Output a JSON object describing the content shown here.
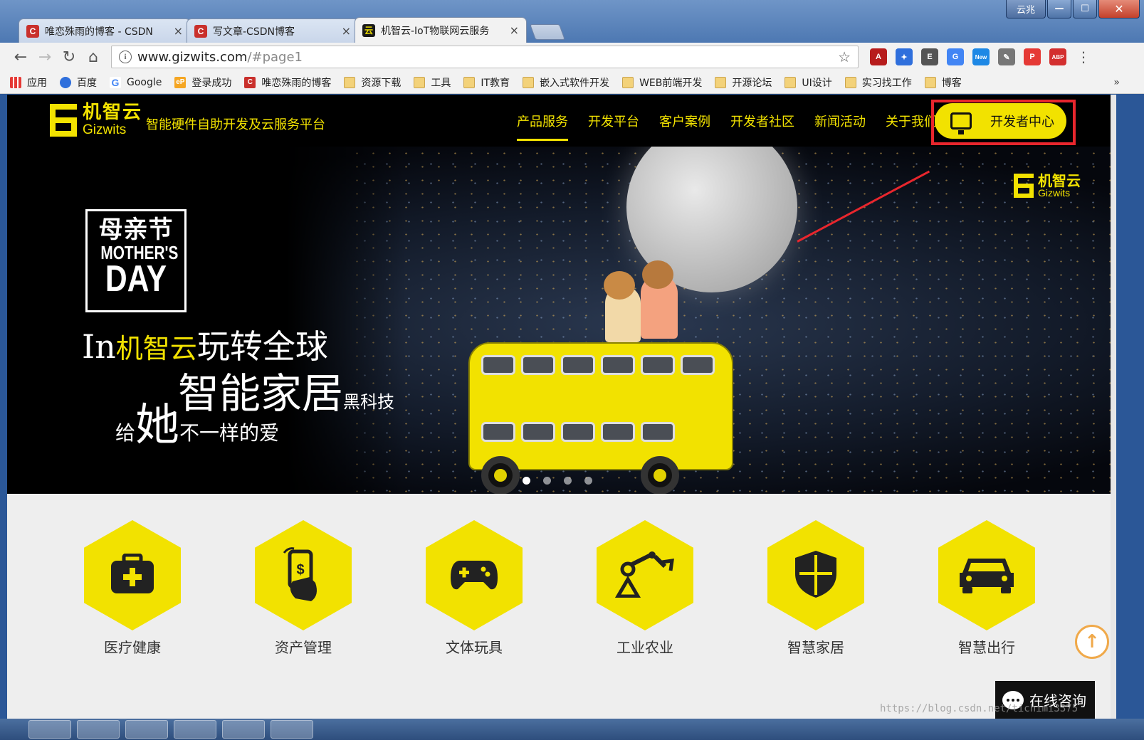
{
  "browser": {
    "window_user_label": "云兆",
    "tabs": [
      {
        "favicon": "C",
        "title": "唯恋殊雨的博客 - CSDN",
        "close": "×"
      },
      {
        "favicon": "C",
        "title": "写文章-CSDN博客",
        "close": "×"
      },
      {
        "favicon": "云",
        "title": "机智云-IoT物联网云服务",
        "close": "×"
      }
    ],
    "address": {
      "host": "www.gizwits.com",
      "path": "/#page1"
    },
    "extensions": [
      {
        "name": "pdf-extension-icon",
        "color": "#b71c1c",
        "glyph": "A"
      },
      {
        "name": "baidu-paw-icon",
        "color": "#2f6fdc",
        "glyph": "✦"
      },
      {
        "name": "evernote-icon",
        "color": "#555555",
        "glyph": "E"
      },
      {
        "name": "translate-icon",
        "color": "#4285f4",
        "glyph": "G"
      },
      {
        "name": "new-extension-icon",
        "color": "#1e88e5",
        "glyph": "New"
      },
      {
        "name": "eyedropper-icon",
        "color": "#777777",
        "glyph": "✎"
      },
      {
        "name": "pocket-icon",
        "color": "#e53935",
        "glyph": "P"
      },
      {
        "name": "adblock-plus-icon",
        "color": "#d32f2f",
        "glyph": "ABP"
      }
    ],
    "bookmarks": [
      {
        "icon": "apps",
        "label": "应用"
      },
      {
        "icon": "baidu",
        "label": "百度"
      },
      {
        "icon": "google",
        "label": "Google"
      },
      {
        "icon": "ep",
        "label": "登录成功"
      },
      {
        "icon": "csdn",
        "label": "唯恋殊雨的博客"
      },
      {
        "icon": "folder",
        "label": "资源下载"
      },
      {
        "icon": "folder",
        "label": "工具"
      },
      {
        "icon": "folder",
        "label": "IT教育"
      },
      {
        "icon": "folder",
        "label": "嵌入式软件开发"
      },
      {
        "icon": "folder",
        "label": "WEB前端开发"
      },
      {
        "icon": "folder",
        "label": "开源论坛"
      },
      {
        "icon": "folder",
        "label": "UI设计"
      },
      {
        "icon": "folder",
        "label": "实习找工作"
      },
      {
        "icon": "folder",
        "label": "博客"
      }
    ],
    "bookmarks_more": "»"
  },
  "site": {
    "logo_cn": "机智云",
    "logo_en": "Gizwits",
    "slogan": "智能硬件自助开发及云服务平台",
    "nav": [
      "产品服务",
      "开发平台",
      "客户案例",
      "开发者社区",
      "新闻活动",
      "关于我们"
    ],
    "dev_center": "开发者中心",
    "accent": "#f2e200",
    "annotation_color": "#e8262d"
  },
  "banner": {
    "logo_cn": "机智云",
    "logo_en": "Gizwits",
    "mothers_day_cn": "母亲节",
    "mothers_day_en1": "MOTHER'S",
    "mothers_day_en2": "DAY",
    "line1_prefix": "In",
    "line1_brand": "机智云",
    "line1_suffix": "玩转全球",
    "line2": "智能家居",
    "line2_small": "黑科技",
    "line3_prefix": "给",
    "line3_big": "她",
    "line3_suffix": "不一样的爱",
    "slides": 4,
    "active_slide": 1
  },
  "industries": [
    {
      "icon": "medical-kit-icon",
      "label": "医疗健康"
    },
    {
      "icon": "phone-payment-icon",
      "label": "资产管理"
    },
    {
      "icon": "gamepad-icon",
      "label": "文体玩具"
    },
    {
      "icon": "robot-arm-icon",
      "label": "工业农业"
    },
    {
      "icon": "shield-icon",
      "label": "智慧家居"
    },
    {
      "icon": "car-icon",
      "label": "智慧出行"
    }
  ],
  "chat": {
    "label": "在线咨询"
  },
  "to_top": "↑",
  "watermark": "https://blog.csdn.net/tichimi3375"
}
